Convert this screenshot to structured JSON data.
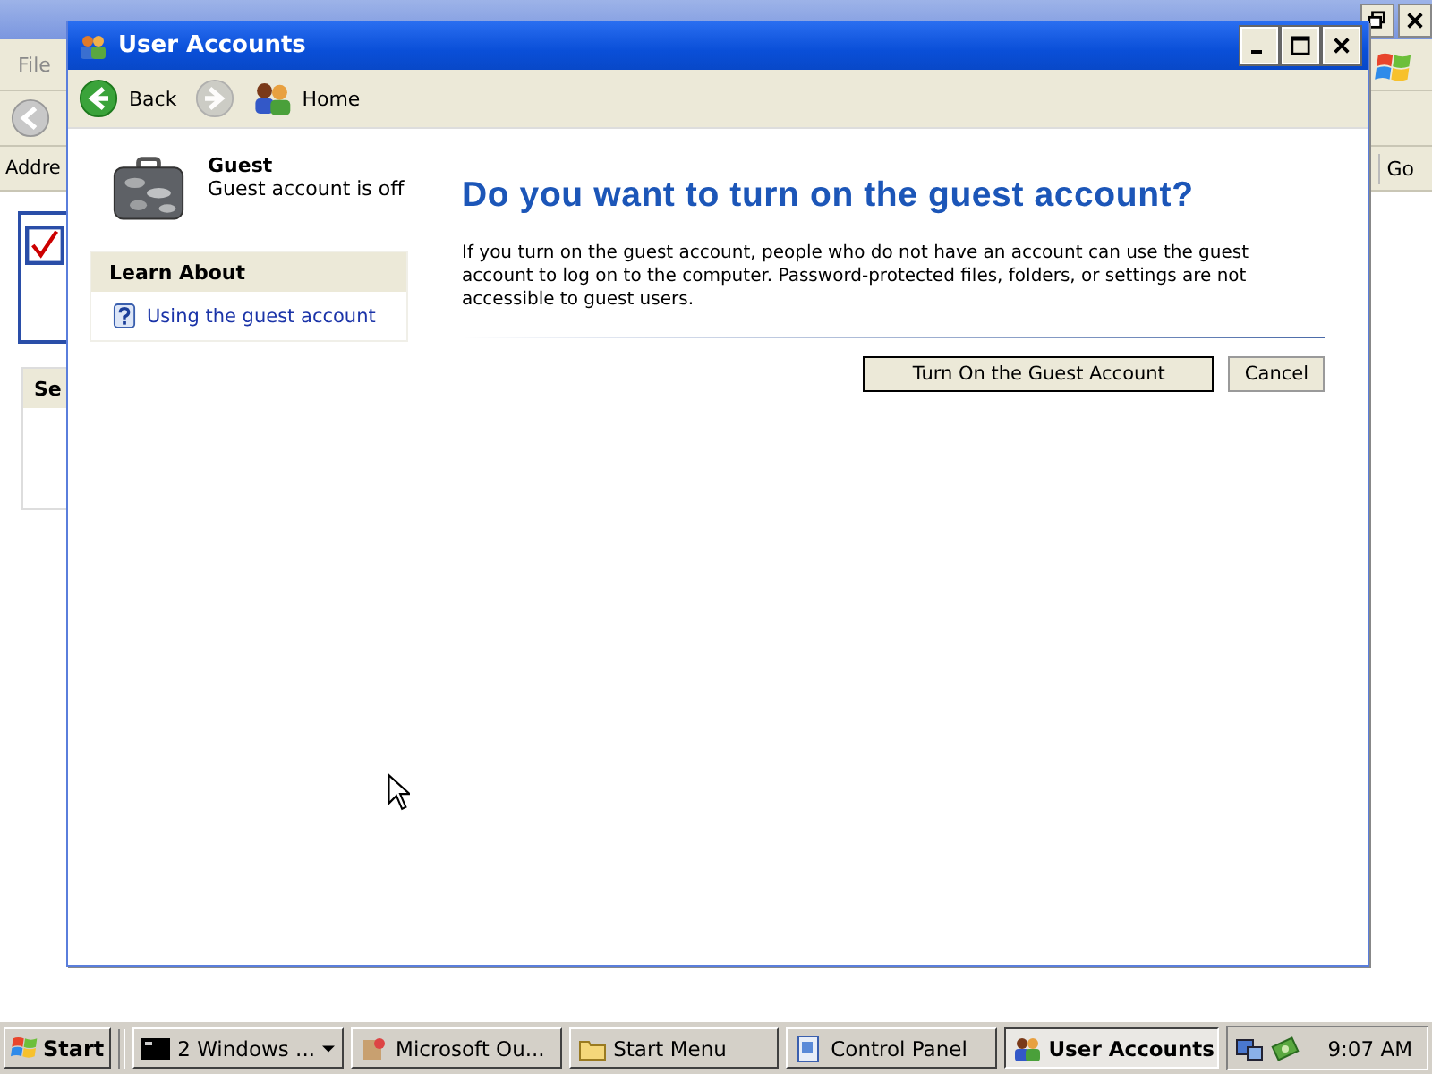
{
  "background_window": {
    "menu": [
      "File"
    ],
    "address_label": "Addre",
    "go_button": "Go",
    "panel_heading": "Se"
  },
  "window": {
    "title": "User Accounts"
  },
  "toolbar": [
    {
      "kind": "back",
      "label": "Back",
      "disabled": false
    },
    {
      "kind": "forward",
      "disabled": true
    },
    {
      "kind": "home",
      "label": "Home",
      "disabled": false
    }
  ],
  "account": {
    "name": "Guest",
    "status": "Guest account is off"
  },
  "learn_about": {
    "title": "Learn About",
    "links": [
      "Using the guest account"
    ]
  },
  "heading": "Do you want to turn on the guest account?",
  "description": "If you turn on the guest account, people who do not have an account can use the guest account to log on to the computer. Password-protected files, folders, or settings are not accessible to guest users.",
  "buttons": [
    {
      "label": "Turn On the Guest Account",
      "default": true
    },
    {
      "label": "Cancel",
      "default": false
    }
  ],
  "taskbar": {
    "start": "Start",
    "tasks": [
      {
        "kind": "console",
        "label": "2 Windows ...",
        "group": true,
        "selected": false
      },
      {
        "kind": "mail",
        "label": "Microsoft Ou...",
        "group": false,
        "selected": false
      },
      {
        "kind": "folder",
        "label": "Start Menu",
        "group": false,
        "selected": false
      },
      {
        "kind": "panel",
        "label": "Control Panel",
        "group": false,
        "selected": false
      },
      {
        "kind": "users",
        "label": "User Accounts",
        "group": false,
        "selected": true
      }
    ],
    "clock": "9:07 AM"
  }
}
